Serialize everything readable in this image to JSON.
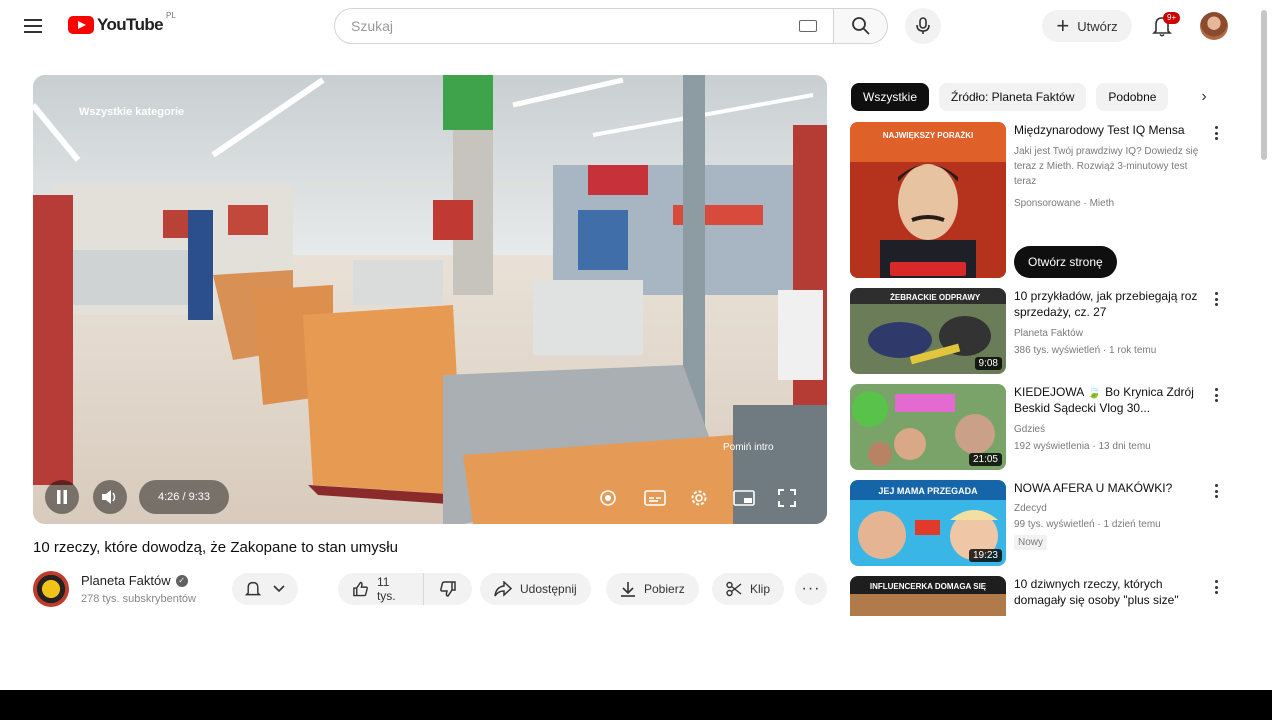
{
  "header": {
    "logo_text": "YouTube",
    "logo_country": "PL",
    "search_placeholder": "Szukaj",
    "create_label": "Utwórz",
    "notifications_badge": "9+"
  },
  "player": {
    "overlay_label": "Wszystkie kategorie",
    "time": "4:26 / 9:33",
    "progress_fraction": 0.56,
    "skip_hint": "Pomiń intro"
  },
  "video": {
    "title": "10 rzeczy, które dowodzą, że Zakopane to stan umysłu",
    "channel_name": "Planeta Faktów",
    "subscribers": "278 tys. subskrybentów",
    "likes": "11 tys.",
    "share_label": "Udostępnij",
    "download_label": "Pobierz",
    "clip_label": "Klip"
  },
  "sidebar": {
    "chips": [
      "Wszystkie",
      "Źródło: Planeta Faktów",
      "Podobne"
    ],
    "recommendations": [
      {
        "title": "Międzynarodowy Test IQ Mensa",
        "meta1": "Jaki jest Twój prawdziwy IQ? Dowiedz się teraz z Mieth. Rozwiąż 3-minutowy test teraz",
        "meta2": "Sponsorowane · Mieth",
        "ad_button": "Otwórz stronę",
        "thumb_text": "NAJWIĘKSZY PORAŻKI"
      },
      {
        "title": "10 przykładów, jak przebiegają roz sprzedaży, cz. 27",
        "channel": "Planeta Faktów",
        "meta": "386 tys. wyświetleń · 1 rok temu",
        "duration": "9:08",
        "thumb_text": "ŻEBRACKIE ODPRAWY"
      },
      {
        "title": "KIEDEJOWA 🍃 Bo Krynica Zdrój Beskid Sądecki Vlog 30...",
        "channel": "Gdzieś",
        "meta": "192 wyświetlenia · 13 dni temu",
        "duration": "21:05",
        "thumb_text": ""
      },
      {
        "title": "NOWA AFERA U MAKÓWKI?",
        "channel": "Zdecyd",
        "meta": "99 tys. wyświetleń · 1 dzień temu",
        "badge": "Nowy",
        "duration": "19:23",
        "thumb_text": "JEJ MAMA PRZEGADA"
      },
      {
        "title": "10 dziwnych rzeczy, których domagały się osoby \"plus size\"",
        "thumb_text": "INFLUENCERKA DOMAGA SIĘ"
      }
    ]
  }
}
